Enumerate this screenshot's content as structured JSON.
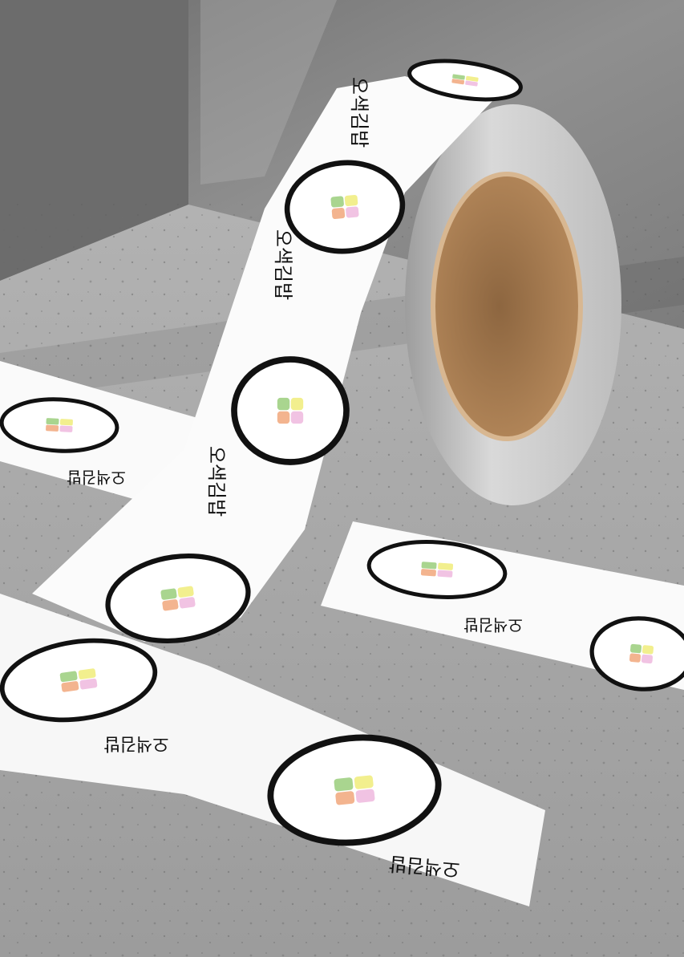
{
  "brand": {
    "wordmark": "오색김밥",
    "logo_colors": [
      "#a9d58f",
      "#f2ef8e",
      "#f3b48f",
      "#f1c3e3"
    ],
    "ring_color": "#111111"
  },
  "colors": {
    "wall": "#8e8e8e",
    "floor": "#a8a8a8",
    "tape": "#fbfbfb",
    "roll_edge": "#cfcfcf",
    "core": "#b48659"
  }
}
